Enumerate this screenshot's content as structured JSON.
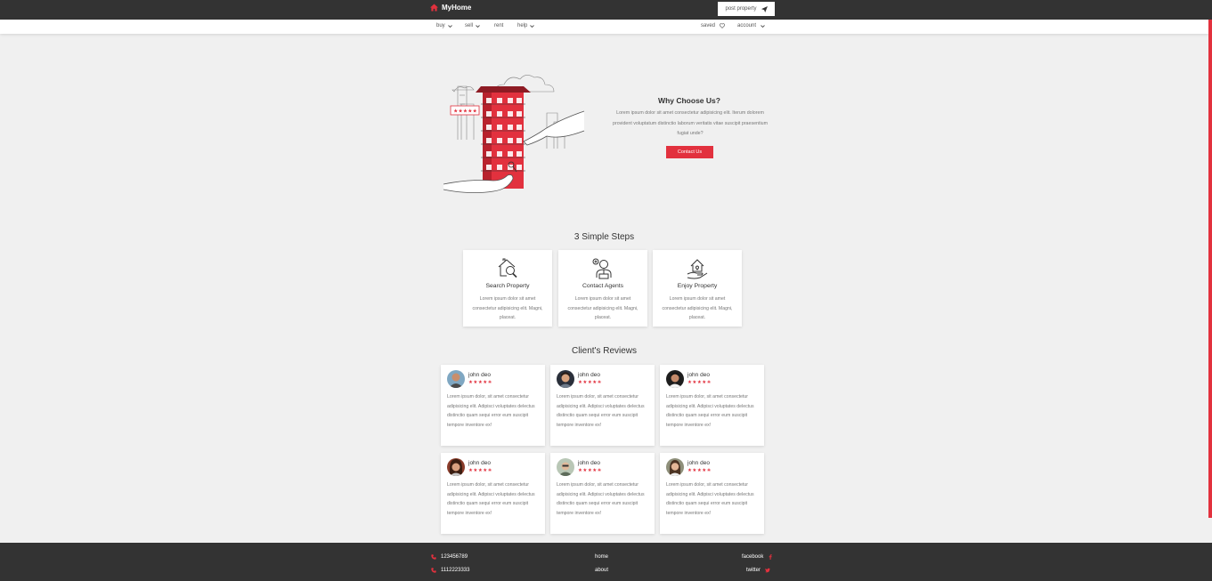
{
  "header": {
    "brand": "MyHome",
    "post_property_label": "post property"
  },
  "nav": {
    "left": [
      {
        "label": "buy"
      },
      {
        "label": "sell"
      },
      {
        "label": "rent"
      },
      {
        "label": "help"
      }
    ],
    "saved_label": "saved",
    "account_label": "account"
  },
  "why": {
    "title": "Why Choose Us?",
    "text": "Lorem ipsum dolor sit amet consectetur adipisicing elit. Iterum dolorem provident voluptatum distinctio laborum veritatis vitae suscipit praesentium fugiat unde?",
    "button_label": "Contact Us"
  },
  "steps": {
    "title": "3 Simple Steps",
    "items": [
      {
        "title": "Search Property",
        "text": "Lorem ipsum dolor sit amet consectetur adipisicing elit. Magni, placeat.",
        "icon": "house-search-icon"
      },
      {
        "title": "Contact Agents",
        "text": "Lorem ipsum dolor sit amet consectetur adipisicing elit. Magni, placeat.",
        "icon": "agent-icon"
      },
      {
        "title": "Enjoy Property",
        "text": "Lorem ipsum dolor sit amet consectetur adipisicing elit. Magni, placeat.",
        "icon": "house-hand-icon"
      }
    ]
  },
  "reviews": {
    "title": "Client's Reviews",
    "stars": "★★★★✬",
    "items": [
      {
        "name": "john deo",
        "text": "Lorem ipsum dolor, sit amet consectetur adipisicing elit. Adipisci voluptates delectus distinctio quam sequi error eum suscipit tempore inventore ex!"
      },
      {
        "name": "john deo",
        "text": "Lorem ipsum dolor, sit amet consectetur adipisicing elit. Adipisci voluptates delectus distinctio quam sequi error eum suscipit tempore inventore ex!"
      },
      {
        "name": "john deo",
        "text": "Lorem ipsum dolor, sit amet consectetur adipisicing elit. Adipisci voluptates delectus distinctio quam sequi error eum suscipit tempore inventore ex!"
      },
      {
        "name": "john deo",
        "text": "Lorem ipsum dolor, sit amet consectetur adipisicing elit. Adipisci voluptates delectus distinctio quam sequi error eum suscipit tempore inventore ex!"
      },
      {
        "name": "john deo",
        "text": "Lorem ipsum dolor, sit amet consectetur adipisicing elit. Adipisci voluptates delectus distinctio quam sequi error eum suscipit tempore inventore ex!"
      },
      {
        "name": "john deo",
        "text": "Lorem ipsum dolor, sit amet consectetur adipisicing elit. Adipisci voluptates delectus distinctio quam sequi error eum suscipit tempore inventore ex!"
      }
    ]
  },
  "footer": {
    "phones": [
      "123456789",
      "1112223333"
    ],
    "links": [
      "home",
      "about"
    ],
    "social": [
      "facebook",
      "twitter"
    ]
  },
  "colors": {
    "accent": "#e2313e",
    "dark": "#333333",
    "background": "#f0f0f0"
  }
}
